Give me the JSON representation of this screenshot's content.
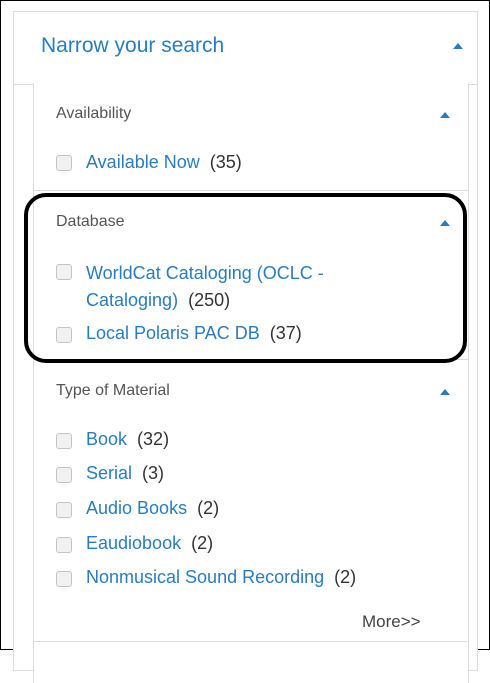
{
  "panel": {
    "title": "Narrow your search"
  },
  "facets": {
    "availability": {
      "title": "Availability",
      "items": [
        {
          "label": "Available Now",
          "count": "(35)"
        }
      ]
    },
    "database": {
      "title": "Database",
      "items": [
        {
          "label_line1": "WorldCat Cataloging (OCLC -",
          "label_line2": "Cataloging)",
          "count": "(250)"
        },
        {
          "label": "Local Polaris PAC DB",
          "count": "(37)"
        }
      ]
    },
    "type_of_material": {
      "title": "Type of Material",
      "items": [
        {
          "label": "Book",
          "count": "(32)"
        },
        {
          "label": "Serial",
          "count": "(3)"
        },
        {
          "label": "Audio Books",
          "count": "(2)"
        },
        {
          "label": "Eaudiobook",
          "count": "(2)"
        },
        {
          "label": "Nonmusical Sound Recording",
          "count": "(2)"
        }
      ],
      "more_label": "More>>"
    }
  },
  "colors": {
    "link": "#2a7cbf",
    "highlight_outline": "#000000"
  },
  "icons": {
    "collapse": "caret-up-icon",
    "checkbox": "checkbox-icon"
  }
}
